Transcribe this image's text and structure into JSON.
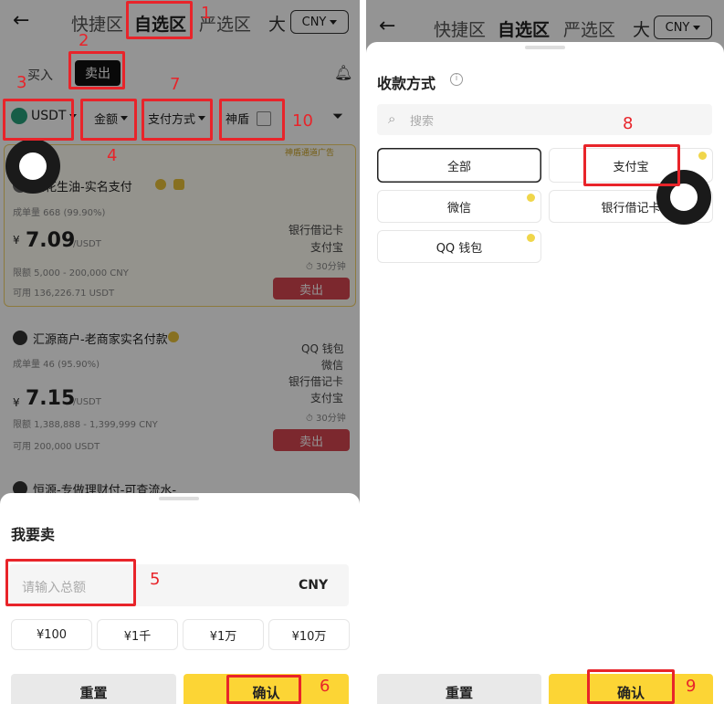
{
  "left": {
    "topbar": {
      "tabs": [
        "快捷区",
        "自选区",
        "严选区"
      ],
      "extra": "大",
      "currency": "CNY"
    },
    "trade_tabs": {
      "buy": "买入",
      "sell": "卖出"
    },
    "filters": {
      "coin": "USDT",
      "amount": "金额",
      "payment": "支付方式",
      "shield": "神盾"
    },
    "merchants": [
      {
        "name": "花花生油-实名支付",
        "orders": "成单量 668 (99.90%)",
        "price_currency": "¥",
        "price": "7.09",
        "price_unit": "/USDT",
        "limit": "限额 5,000 - 200,000 CNY",
        "available": "可用 136,226.71 USDT",
        "methods": [
          "银行借记卡",
          "支付宝"
        ],
        "time": "30分钟",
        "action": "卖出",
        "tag": "神盾通道广告"
      },
      {
        "name": "汇源商户-老商家实名付款",
        "orders": "成单量 46 (95.90%)",
        "price_currency": "¥",
        "price": "7.15",
        "price_unit": "/USDT",
        "limit": "限额 1,388,888 - 1,399,999 CNY",
        "available": "可用 200,000 USDT",
        "methods": [
          "QQ 钱包",
          "微信",
          "银行借记卡",
          "支付宝"
        ],
        "time": "30分钟",
        "action": "卖出"
      },
      {
        "name": "恒源-专做理财付-可查流水-"
      }
    ],
    "sheet": {
      "title": "我要卖",
      "input_placeholder": "请输入总额",
      "input_currency": "CNY",
      "quick_amounts": [
        "¥100",
        "¥1千",
        "¥1万",
        "¥10万"
      ],
      "reset": "重置",
      "confirm": "确认"
    },
    "annotations": [
      "1",
      "2",
      "3",
      "4",
      "5",
      "6",
      "7",
      "10"
    ]
  },
  "right": {
    "topbar": {
      "tabs": [
        "快捷区",
        "自选区",
        "严选区"
      ],
      "extra": "大",
      "currency": "CNY"
    },
    "sheet": {
      "title": "收款方式",
      "search_placeholder": "搜索",
      "options": [
        "全部",
        "支付宝",
        "微信",
        "银行借记卡",
        "QQ 钱包"
      ],
      "reset": "重置",
      "confirm": "确认"
    },
    "annotations": [
      "8",
      "9"
    ]
  },
  "colors": {
    "accent_yellow": "#fcd535",
    "annotation_red": "#e8242a",
    "sell_red": "#d64550"
  }
}
